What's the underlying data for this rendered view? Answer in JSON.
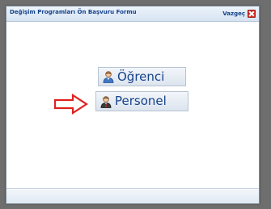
{
  "dialog": {
    "title": "Değişim Programları Ön Başvuru Formu",
    "close_label": "Vazgeç"
  },
  "choices": {
    "student_label": "Öğrenci",
    "staff_label": "Personel"
  },
  "icons": {
    "close": "close-icon",
    "student": "student-user-icon",
    "staff": "staff-user-icon",
    "pointer": "right-arrow-icon"
  },
  "colors": {
    "title_text": "#15428b",
    "close_icon": "#d72d26",
    "arrow": "#e02020"
  }
}
